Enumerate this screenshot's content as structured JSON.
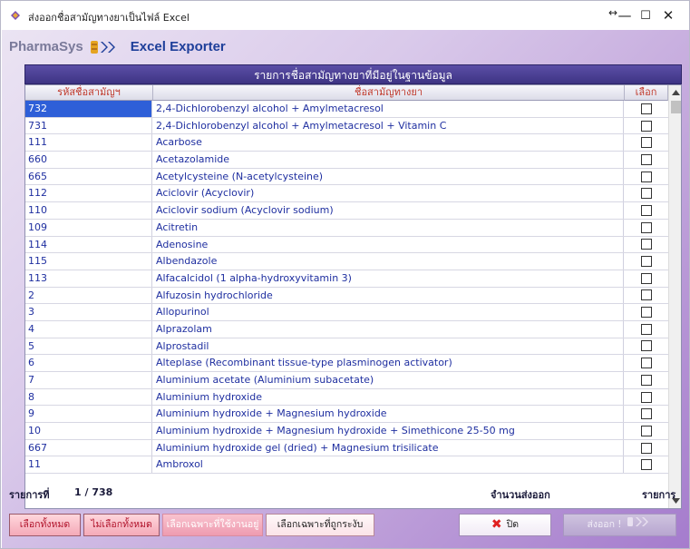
{
  "window": {
    "title": "ส่งออกชื่อสามัญทางยาเป็นไฟล์ Excel",
    "controls": {
      "minimize": "—",
      "maximize": "☐",
      "close": "✕",
      "resize": "↔"
    }
  },
  "brand": {
    "left": "PharmaSys",
    "right": "Excel Exporter"
  },
  "grid": {
    "caption": "รายการชื่อสามัญทางยาที่มีอยู่ในฐานข้อมูล",
    "columns": {
      "code": "รหัสชื่อสามัญฯ",
      "name": "ชื่อสามัญทางยา",
      "select": "เลือก"
    },
    "rows": [
      {
        "code": "732",
        "name": "2,4-Dichlorobenzyl alcohol + Amylmetacresol",
        "checked": false
      },
      {
        "code": "731",
        "name": "2,4-Dichlorobenzyl alcohol + Amylmetacresol + Vitamin C",
        "checked": false
      },
      {
        "code": "111",
        "name": "Acarbose",
        "checked": false
      },
      {
        "code": "660",
        "name": "Acetazolamide",
        "checked": false
      },
      {
        "code": "665",
        "name": "Acetylcysteine (N-acetylcysteine)",
        "checked": false
      },
      {
        "code": "112",
        "name": "Aciclovir (Acyclovir)",
        "checked": false
      },
      {
        "code": "110",
        "name": "Aciclovir sodium (Acyclovir sodium)",
        "checked": false
      },
      {
        "code": "109",
        "name": "Acitretin",
        "checked": false
      },
      {
        "code": "114",
        "name": "Adenosine",
        "checked": false
      },
      {
        "code": "115",
        "name": "Albendazole",
        "checked": false
      },
      {
        "code": "113",
        "name": "Alfacalcidol (1 alpha-hydroxyvitamin 3)",
        "checked": false
      },
      {
        "code": "2",
        "name": "Alfuzosin hydrochloride",
        "checked": false
      },
      {
        "code": "3",
        "name": "Allopurinol",
        "checked": false
      },
      {
        "code": "4",
        "name": "Alprazolam",
        "checked": false
      },
      {
        "code": "5",
        "name": "Alprostadil",
        "checked": false
      },
      {
        "code": "6",
        "name": "Alteplase (Recombinant tissue-type plasminogen activator)",
        "checked": false
      },
      {
        "code": "7",
        "name": "Aluminium acetate (Aluminium subacetate)",
        "checked": false
      },
      {
        "code": "8",
        "name": "Aluminium hydroxide",
        "checked": false
      },
      {
        "code": "9",
        "name": "Aluminium hydroxide + Magnesium hydroxide",
        "checked": false
      },
      {
        "code": "10",
        "name": "Aluminium hydroxide + Magnesium hydroxide + Simethicone 25-50 mg",
        "checked": false
      },
      {
        "code": "667",
        "name": "Aluminium hydroxide gel (dried) + Magnesium trisilicate",
        "checked": false
      },
      {
        "code": "11",
        "name": "Ambroxol",
        "checked": false
      }
    ],
    "selected_row_index": 0
  },
  "footer": {
    "record_label": "รายการที่",
    "record_position": "1 / 738",
    "export_count_label": "จำนวนส่งออก",
    "export_unit_label": "รายการ"
  },
  "buttons": {
    "select_all": "เลือกทั้งหมด",
    "deselect_all": "ไม่เลือกทั้งหมด",
    "select_in_use": "เลือกเฉพาะที่ใช้งานอยู่",
    "select_cancelled": "เลือกเฉพาะที่ถูกระงับ",
    "close": "ปิด",
    "export": "ส่งออก !"
  },
  "icons": {
    "app": "pill-app-icon",
    "close": "x-icon",
    "export": "double-chevron-icon"
  },
  "colors": {
    "header_band": "#4a3f96",
    "selected_row": "#2e5fd8",
    "text_blue": "#1f2fa0",
    "header_red": "#c0392b",
    "button_pink": "#f4aab8"
  }
}
